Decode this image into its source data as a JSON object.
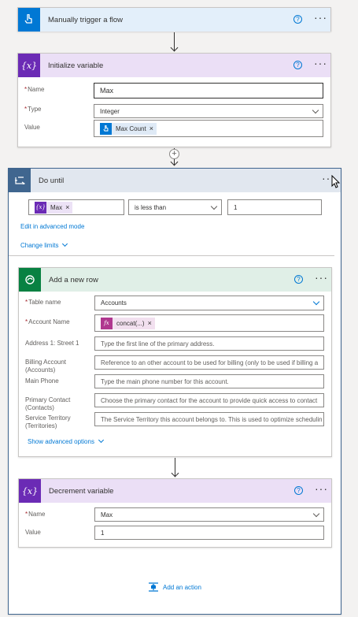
{
  "trigger": {
    "title": "Manually trigger a flow",
    "icon": "hand-touch-icon",
    "color": "#0078d4"
  },
  "init_var": {
    "title": "Initialize variable",
    "icon": "variable-icon",
    "color": "#6b2bb5",
    "name_label": "Name",
    "name_value": "Max",
    "type_label": "Type",
    "type_value": "Integer",
    "value_label": "Value",
    "value_token": "Max Count",
    "value_token_icon": "hand-touch-icon"
  },
  "do_until": {
    "title": "Do until",
    "icon": "loop-icon",
    "color": "#40668f",
    "cond_token": "Max",
    "operator": "is less than",
    "compare_value": "1",
    "advanced_mode_link": "Edit in advanced mode",
    "change_limits_link": "Change limits"
  },
  "add_row": {
    "title": "Add a new row",
    "icon": "dataverse-icon",
    "color": "#088142",
    "fields": [
      {
        "label": "Table name",
        "required": true,
        "value": "Accounts",
        "kind": "select"
      },
      {
        "label": "Account Name",
        "required": true,
        "token": "concat(...)",
        "kind": "token"
      },
      {
        "label": "Address 1: Street 1",
        "required": false,
        "placeholder": "Type the first line of the primary address.",
        "kind": "text"
      },
      {
        "label": "Billing Account (Accounts)",
        "required": false,
        "placeholder": "Reference to an other account to be used for billing (only to be used if billing a",
        "kind": "text"
      },
      {
        "label": "Main Phone",
        "required": false,
        "placeholder": "Type the main phone number for this account.",
        "kind": "text"
      },
      {
        "label": "Primary Contact (Contacts)",
        "required": false,
        "placeholder": "Choose the primary contact for the account to provide quick access to contact",
        "kind": "text"
      },
      {
        "label": "Service Territory (Territories)",
        "required": false,
        "placeholder": "The Service Territory this account belongs to. This is used to optimize schedulin",
        "kind": "text"
      }
    ],
    "advanced_link": "Show advanced options"
  },
  "decrement": {
    "title": "Decrement variable",
    "icon": "variable-icon",
    "color": "#6b2bb5",
    "name_label": "Name",
    "name_value": "Max",
    "value_label": "Value",
    "value_value": "1"
  },
  "add_action": {
    "label": "Add an action",
    "icon": "add-action-icon"
  }
}
